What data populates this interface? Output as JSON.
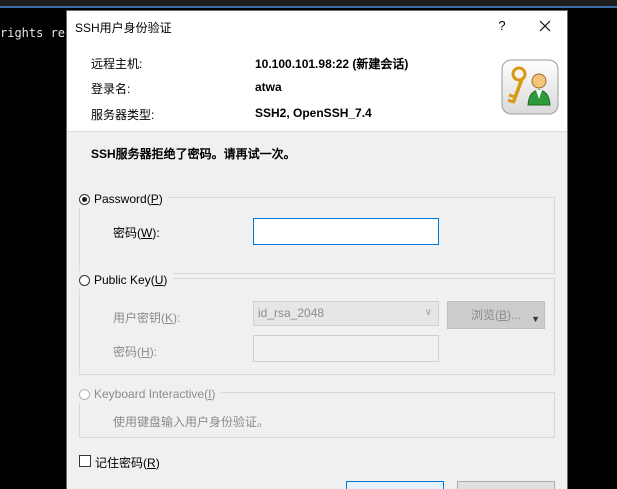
{
  "terminal": {
    "visible_text": "rights res"
  },
  "dialog": {
    "title": "SSH用户身份验证",
    "help_label": "?",
    "info": {
      "host_label": "远程主机:",
      "host_value": "10.100.101.98:22 (新建会话)",
      "login_label": "登录名:",
      "login_value": "atwa",
      "server_type_label": "服务器类型:",
      "server_type_value": "SSH2, OpenSSH_7.4"
    },
    "message": "SSH服务器拒绝了密码。请再试一次。",
    "password_method": {
      "label": "Password",
      "accel": "P",
      "selected": true,
      "field_label": "密码",
      "field_accel": "W",
      "field_value": ""
    },
    "public_key_method": {
      "label": "Public Key",
      "accel": "U",
      "selected": false,
      "key_label": "用户密钥",
      "key_accel": "K",
      "key_value": "id_rsa_2048",
      "browse_label": "浏览",
      "browse_accel": "B",
      "passphrase_label": "密码",
      "passphrase_accel": "H"
    },
    "keyboard_method": {
      "label": "Keyboard Interactive",
      "accel": "I",
      "enabled": false,
      "description": "使用键盘输入用户身份验证。"
    },
    "remember": {
      "label": "记住密码",
      "accel": "R",
      "checked": false
    }
  },
  "colors": {
    "focus_border": "#0078d7",
    "terminal_bg": "#000000",
    "dialog_bg": "#f0f0f0",
    "header_bg": "#ffffff"
  }
}
